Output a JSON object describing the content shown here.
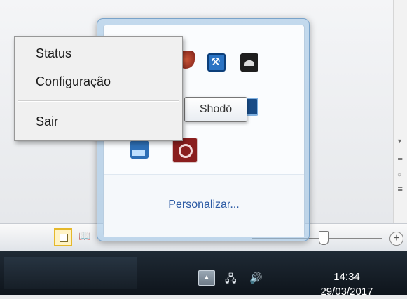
{
  "context_menu": {
    "items": [
      {
        "label": "Status"
      },
      {
        "label": "Configuração"
      },
      {
        "label": "Sair"
      }
    ]
  },
  "tray_flyout": {
    "tooltip": "Shodō",
    "customize_link": "Personalizar...",
    "icons": [
      "shield-icon",
      "wrench-icon",
      "photo-icon",
      "red-app-icon",
      "monitor-icon",
      "scanner-icon",
      "shodo-icon"
    ]
  },
  "taskbar": {
    "time": "14:34",
    "date": "29/03/2017"
  },
  "colors": {
    "taskbar": "#0e141b",
    "link": "#2b5aa4",
    "view_button_accent": "#e5b82b"
  }
}
